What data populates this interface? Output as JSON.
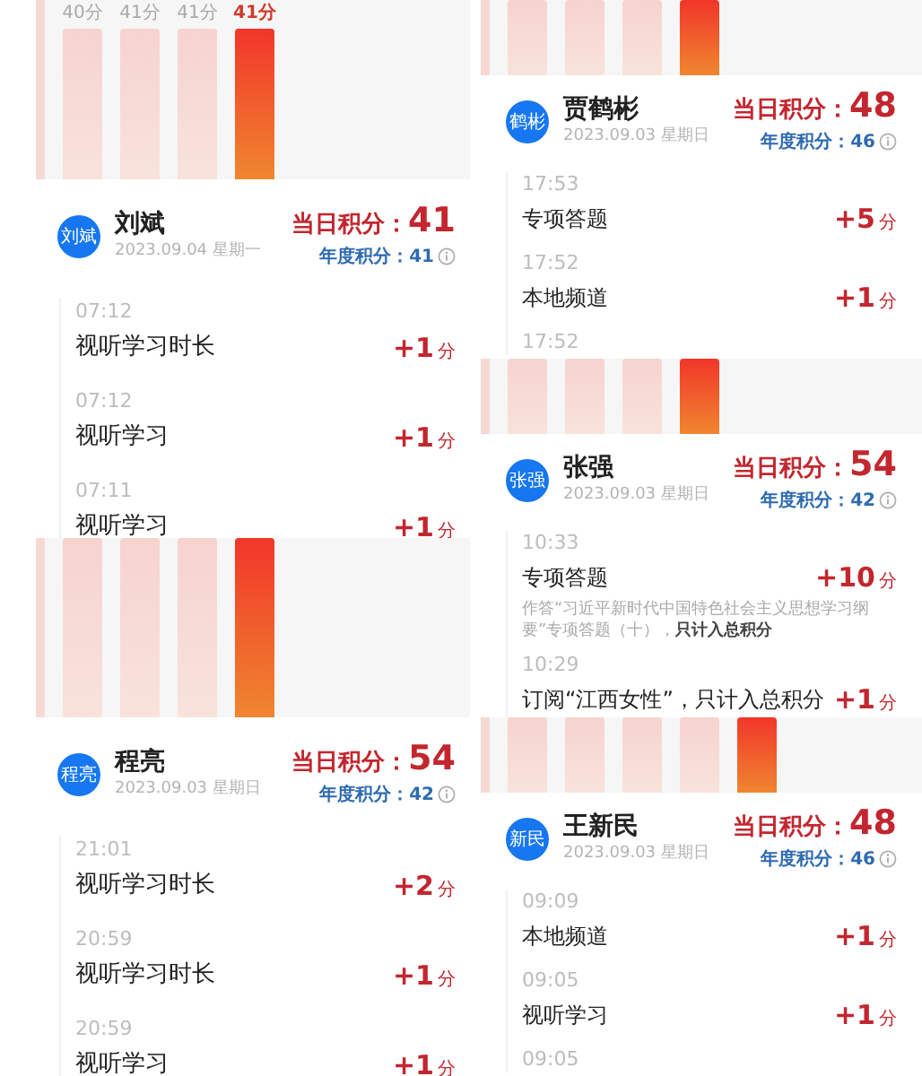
{
  "columns": [
    {
      "kind": "tall",
      "panels": [
        {
          "bars": [
            {
              "label": "40分",
              "selected": false
            },
            {
              "label": "41分",
              "selected": false
            },
            {
              "label": "41分",
              "selected": false
            },
            {
              "label": "41分",
              "selected": true
            }
          ],
          "user": {
            "avatar_text": "刘斌",
            "name": "刘斌",
            "date": "2023.09.04 星期一",
            "daily_label": "当日积分：",
            "daily_score": "41",
            "annual_label": "年度积分：",
            "annual_score": "41"
          },
          "entries": [
            {
              "time": "07:12",
              "title": "视听学习时长",
              "points": "+1",
              "unit": "分"
            },
            {
              "time": "07:12",
              "title": "视听学习",
              "points": "+1",
              "unit": "分"
            },
            {
              "time": "07:11",
              "title": "视听学习",
              "points": "+1",
              "unit": "分"
            }
          ]
        },
        {
          "bars": [
            {
              "selected": false
            },
            {
              "selected": false
            },
            {
              "selected": false
            },
            {
              "selected": true
            }
          ],
          "user": {
            "avatar_text": "程亮",
            "name": "程亮",
            "date": "2023.09.03 星期日",
            "daily_label": "当日积分：",
            "daily_score": "54",
            "annual_label": "年度积分：",
            "annual_score": "42"
          },
          "entries": [
            {
              "time": "21:01",
              "title": "视听学习时长",
              "points": "+2",
              "unit": "分"
            },
            {
              "time": "20:59",
              "title": "视听学习时长",
              "points": "+1",
              "unit": "分"
            },
            {
              "time": "20:59",
              "title": "视听学习",
              "points": "+1",
              "unit": "分"
            }
          ]
        }
      ]
    },
    {
      "kind": "short",
      "panels": [
        {
          "bars": [
            {
              "selected": false
            },
            {
              "selected": false
            },
            {
              "selected": false
            },
            {
              "selected": true
            }
          ],
          "user": {
            "avatar_text": "鹤彬",
            "name": "贾鹤彬",
            "date": "2023.09.03 星期日",
            "daily_label": "当日积分：",
            "daily_score": "48",
            "annual_label": "年度积分：",
            "annual_score": "46"
          },
          "entries": [
            {
              "time": "17:53",
              "title": "专项答题",
              "points": "+5",
              "unit": "分"
            },
            {
              "time": "17:52",
              "title": "本地频道",
              "points": "+1",
              "unit": "分"
            },
            {
              "time": "17:52"
            }
          ]
        },
        {
          "bars": [
            {
              "selected": false
            },
            {
              "selected": false
            },
            {
              "selected": false
            },
            {
              "selected": true
            }
          ],
          "user": {
            "avatar_text": "张强",
            "name": "张强",
            "date": "2023.09.03 星期日",
            "daily_label": "当日积分：",
            "daily_score": "54",
            "annual_label": "年度积分：",
            "annual_score": "42"
          },
          "entries": [
            {
              "time": "10:33",
              "title": "专项答题",
              "note": "作答“习近平新时代中国特色社会主义思想学习纲要”专项答题（十），**只计入总积分**",
              "points": "+10",
              "unit": "分"
            },
            {
              "time": "10:29",
              "title": "订阅“江西女性”，只计入总积分",
              "points": "+1",
              "unit": "分"
            }
          ]
        },
        {
          "bars": [
            {
              "selected": false
            },
            {
              "selected": false
            },
            {
              "selected": false
            },
            {
              "selected": false
            },
            {
              "selected": true
            }
          ],
          "user": {
            "avatar_text": "新民",
            "name": "王新民",
            "date": "2023.09.03 星期日",
            "daily_label": "当日积分：",
            "daily_score": "48",
            "annual_label": "年度积分：",
            "annual_score": "46"
          },
          "entries": [
            {
              "time": "09:09",
              "title": "本地频道",
              "points": "+1",
              "unit": "分"
            },
            {
              "time": "09:05",
              "title": "视听学习",
              "points": "+1",
              "unit": "分"
            },
            {
              "time": "09:05"
            }
          ]
        }
      ]
    }
  ]
}
